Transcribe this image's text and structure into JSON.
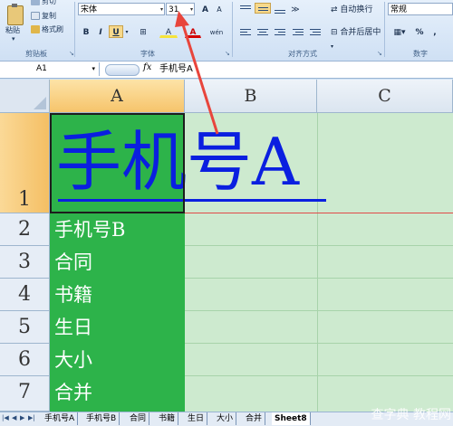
{
  "ribbon": {
    "clipboard": {
      "paste_label": "粘贴",
      "cut_label": "剪切",
      "copy_label": "复制",
      "painter_label": "格式刷",
      "group_label": "剪贴板"
    },
    "font": {
      "font_name": "宋体",
      "font_size": "31",
      "grow_label": "A",
      "shrink_label": "A",
      "bold_label": "B",
      "italic_label": "I",
      "underline_label": "U",
      "border_label": "⊞",
      "fill_label": "A",
      "color_label": "A",
      "phonetic_label": "wén",
      "group_label": "字体"
    },
    "alignment": {
      "wrap_label": "自动换行",
      "merge_label": "合并后居中",
      "group_label": "对齐方式"
    },
    "number": {
      "format": "常规",
      "percent_label": "%",
      "comma_label": ",",
      "group_label": "数字"
    }
  },
  "formula_bar": {
    "name_box": "A1",
    "fx": "fx",
    "value": "手机号A"
  },
  "grid": {
    "columns": [
      "A",
      "B",
      "C"
    ],
    "rows": [
      "1",
      "2",
      "3",
      "4",
      "5",
      "6",
      "7"
    ],
    "a1_text": "手机号A",
    "cells": [
      "手机号B",
      "合同",
      "书籍",
      "生日",
      "大小",
      "合并"
    ]
  },
  "sheet_tabs": [
    "手机号A",
    "手机号B",
    "合同",
    "书籍",
    "生日",
    "大小",
    "合并",
    "Sheet8"
  ],
  "watermark": "查字典 教程网",
  "colors": {
    "cell_fill": "#2db34a",
    "a1_text": "#0a1fe0",
    "arrow": "#e8453c"
  }
}
